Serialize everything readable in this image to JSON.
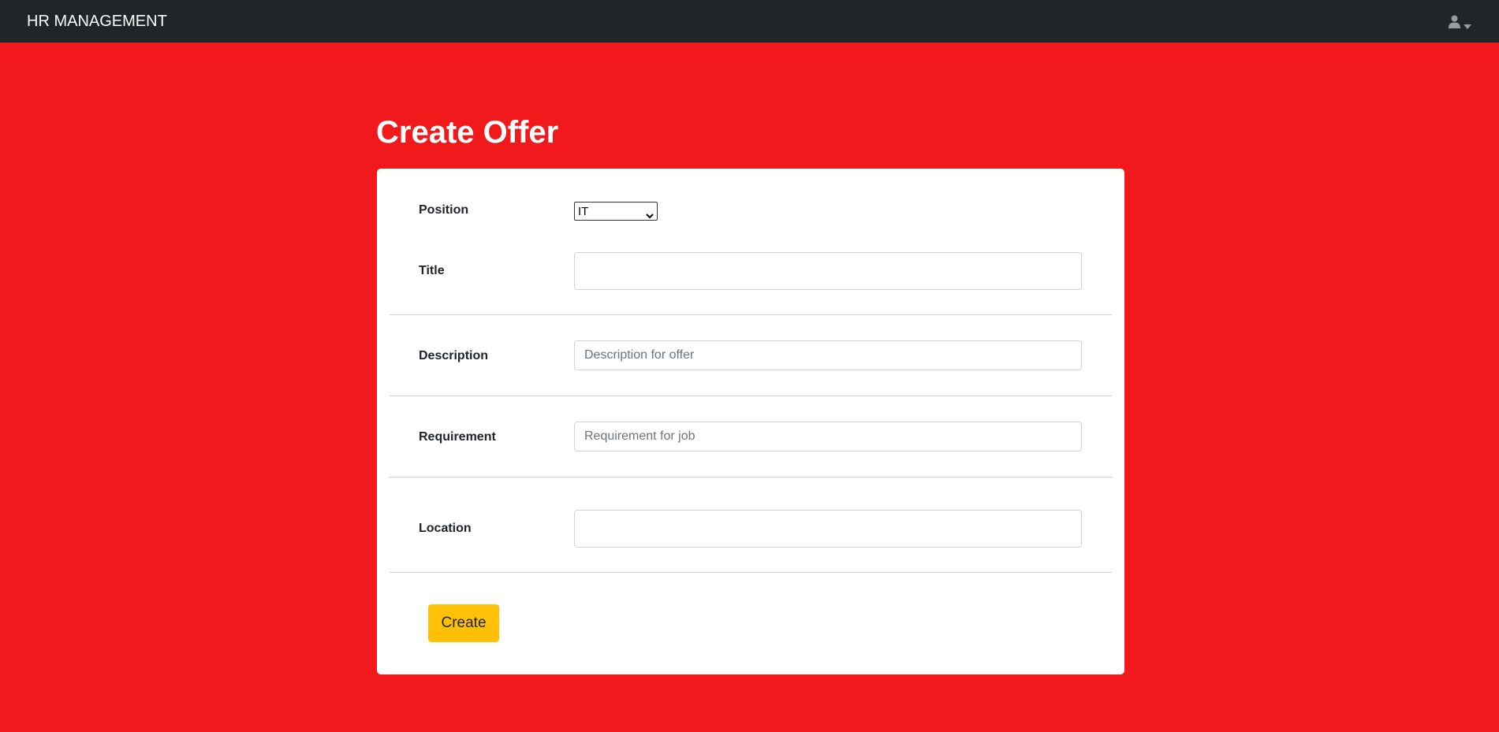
{
  "navbar": {
    "brand": "HR MANAGEMENT",
    "user_icon": "user-icon",
    "caret_icon": "caret-down-icon"
  },
  "page": {
    "title": "Create Offer"
  },
  "form": {
    "position": {
      "label": "Position",
      "selected": "IT"
    },
    "title": {
      "label": "Title",
      "value": "",
      "placeholder": ""
    },
    "description": {
      "label": "Description",
      "value": "",
      "placeholder": "Description for offer"
    },
    "requirement": {
      "label": "Requirement",
      "value": "",
      "placeholder": "Requirement for job"
    },
    "location": {
      "label": "Location",
      "value": "",
      "placeholder": ""
    },
    "submit_label": "Create"
  },
  "colors": {
    "background": "#f2191c",
    "navbar": "#212529",
    "button": "#ffc107"
  }
}
